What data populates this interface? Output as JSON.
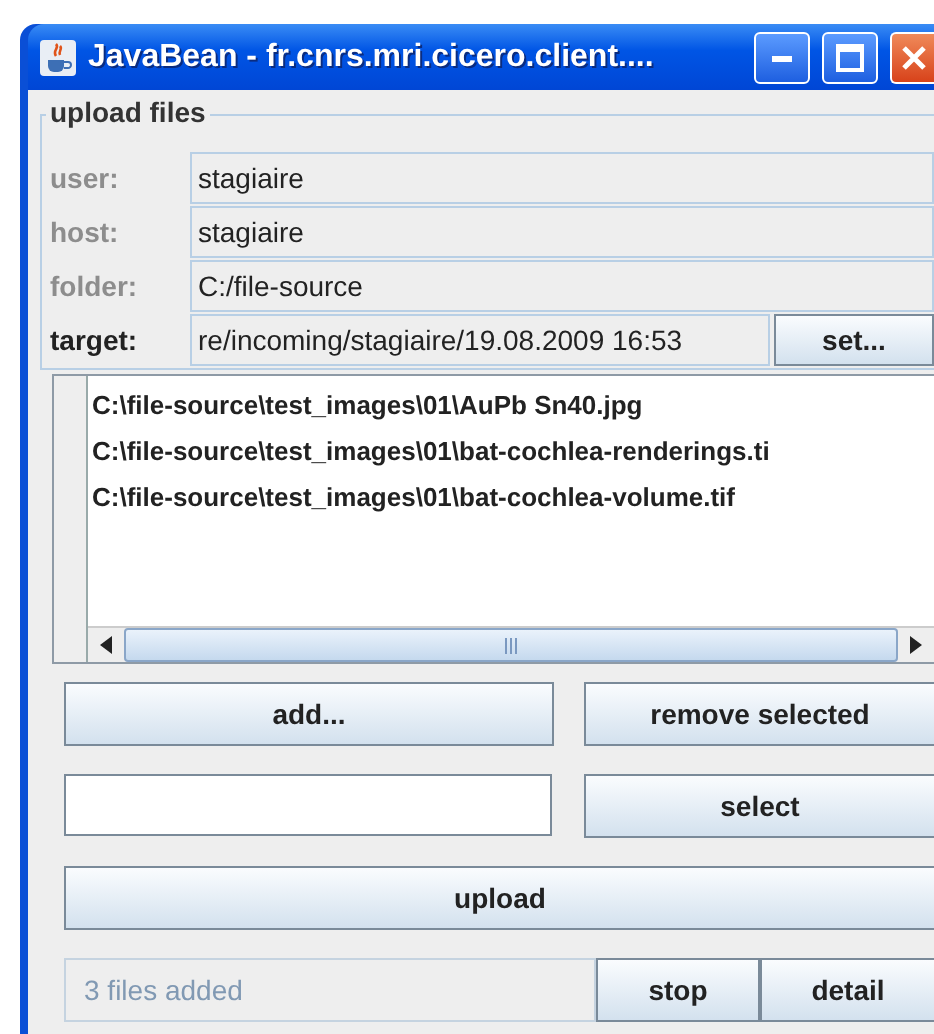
{
  "window": {
    "title": "JavaBean - fr.cnrs.mri.cicero.client...."
  },
  "group": {
    "title": "upload files"
  },
  "fields": [
    {
      "label": "user:",
      "value": "stagiaire",
      "disabled": true
    },
    {
      "label": "host:",
      "value": "stagiaire",
      "disabled": true
    },
    {
      "label": "folder:",
      "value": "C:/file-source",
      "disabled": true
    },
    {
      "label": "target:",
      "value": "re/incoming/stagiaire/19.08.2009 16:53",
      "disabled": false,
      "button": "set..."
    }
  ],
  "file_list": {
    "items": [
      "C:\\file-source\\test_images\\01\\AuPb Sn40.jpg",
      "C:\\file-source\\test_images\\01\\bat-cochlea-renderings.ti",
      "C:\\file-source\\test_images\\01\\bat-cochlea-volume.tif"
    ]
  },
  "buttons": {
    "add": "add...",
    "remove": "remove selected",
    "select": "select",
    "upload": "upload",
    "stop": "stop",
    "detail": "detail"
  },
  "status": {
    "text": "3 files added",
    "disabled": true
  }
}
